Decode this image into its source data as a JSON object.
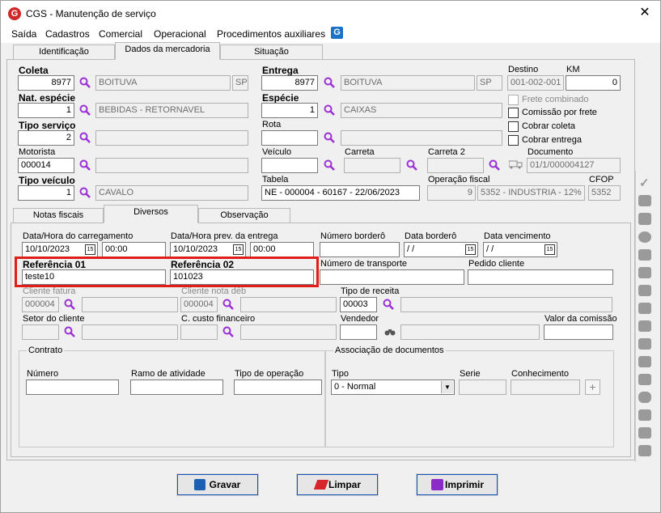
{
  "window": {
    "title": "CGS - Manutenção de serviço",
    "close": "✕"
  },
  "menu": [
    "Saída",
    "Cadastros",
    "Comercial",
    "Operacional",
    "Procedimentos auxiliares"
  ],
  "top_tabs": [
    "Identificação",
    "Dados da mercadoria",
    "Situação"
  ],
  "coleta": {
    "label": "Coleta",
    "code": "8977",
    "city": "BOITUVA",
    "uf": "SP"
  },
  "entrega": {
    "label": "Entrega",
    "code": "8977",
    "city": "BOITUVA",
    "uf": "SP"
  },
  "destino": {
    "label": "Destino",
    "value": "001-002-001"
  },
  "km": {
    "label": "KM",
    "value": "0"
  },
  "nat_especie": {
    "label": "Nat. espécie",
    "code": "1",
    "desc": "BEBIDAS - RETORNAVEL"
  },
  "especie": {
    "label": "Espécie",
    "code": "1",
    "desc": "CAIXAS"
  },
  "checks": [
    "Frete combinado",
    "Comissão por frete",
    "Cobrar coleta",
    "Cobrar entrega"
  ],
  "tipo_servico": {
    "label": "Tipo serviço",
    "code": "2"
  },
  "rota": {
    "label": "Rota"
  },
  "motorista": {
    "label": "Motorista",
    "code": "000014"
  },
  "veiculo": {
    "label": "Veículo"
  },
  "carreta": {
    "label": "Carreta"
  },
  "carreta2": {
    "label": "Carreta 2"
  },
  "documento": {
    "label": "Documento",
    "value": "01/1/000004127"
  },
  "tipo_veiculo": {
    "label": "Tipo veículo",
    "code": "1",
    "desc": "CAVALO"
  },
  "tabela": {
    "label": "Tabela",
    "value": "NE - 000004 - 60167 - 22/06/2023"
  },
  "operacao_fiscal": {
    "label": "Operação fiscal",
    "code": "9",
    "desc": "5352 - INDUSTRIA - 12%"
  },
  "cfop": {
    "label": "CFOP",
    "value": "5352"
  },
  "sub_tabs": [
    "Notas fiscais",
    "Diversos",
    "Observação"
  ],
  "data_carregamento": {
    "label": "Data/Hora do carregamento",
    "date": "10/10/2023",
    "time": "00:00"
  },
  "data_entrega": {
    "label": "Data/Hora prev. da entrega",
    "date": "10/10/2023",
    "time": "00:00"
  },
  "numero_bordero": {
    "label": "Número borderô"
  },
  "data_bordero": {
    "label": "Data borderô",
    "value": " / /"
  },
  "data_vencimento": {
    "label": "Data vencimento",
    "value": " / /"
  },
  "ref01": {
    "label": "Referência 01",
    "value": "teste10"
  },
  "ref02": {
    "label": "Referência 02",
    "value": "101023"
  },
  "numero_transporte": {
    "label": "Número de transporte"
  },
  "pedido_cliente": {
    "label": "Pedido cliente"
  },
  "cliente_fatura": {
    "label": "Cliente fatura",
    "code": "000004"
  },
  "cliente_nota": {
    "label": "Cliente nota déb",
    "code": "000004"
  },
  "tipo_receita": {
    "label": "Tipo de receita",
    "code": "00003"
  },
  "setor_cliente": {
    "label": "Setor do cliente"
  },
  "custo_financeiro": {
    "label": "C. custo financeiro"
  },
  "vendedor": {
    "label": "Vendedor"
  },
  "valor_comissao": {
    "label": "Valor da comissão"
  },
  "contrato": {
    "title": "Contrato",
    "numero": "Número",
    "ramo": "Ramo de atividade",
    "tipo_op": "Tipo de operação"
  },
  "assoc": {
    "title": "Associação de documentos",
    "tipo": "Tipo",
    "tipo_value": "0 - Normal",
    "serie": "Serie",
    "conhecimento": "Conhecimento",
    "add": "+"
  },
  "buttons": {
    "gravar": "Gravar",
    "limpar": "Limpar",
    "imprimir": "Imprimir"
  },
  "colors": {
    "highlight": "#e21b1b",
    "icon_purple": "#9b2fd6",
    "button_border": "#0f52ba"
  }
}
